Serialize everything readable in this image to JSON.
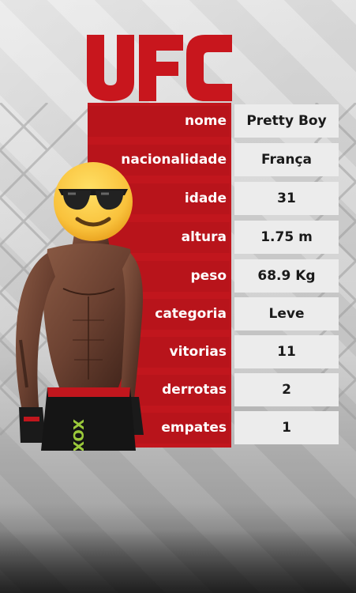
{
  "logo": {
    "text": "UFC"
  },
  "stats": [
    {
      "label": "nome",
      "value": "Pretty Boy"
    },
    {
      "label": "nacionalidade",
      "value": "França"
    },
    {
      "label": "idade",
      "value": "31"
    },
    {
      "label": "altura",
      "value": "1.75 m"
    },
    {
      "label": "peso",
      "value": "68.9 Kg"
    },
    {
      "label": "categoria",
      "value": "Leve"
    },
    {
      "label": "vitorias",
      "value": "11"
    },
    {
      "label": "derrotas",
      "value": "2"
    },
    {
      "label": "empates",
      "value": "1"
    }
  ],
  "fighter": {
    "shorts_text": "XOX",
    "emoji": "sunglasses-face"
  },
  "colors": {
    "ufc_red": "#c1161d",
    "value_bg": "#ececec",
    "label_text": "#ffffff",
    "value_text": "#1a1a1a"
  }
}
